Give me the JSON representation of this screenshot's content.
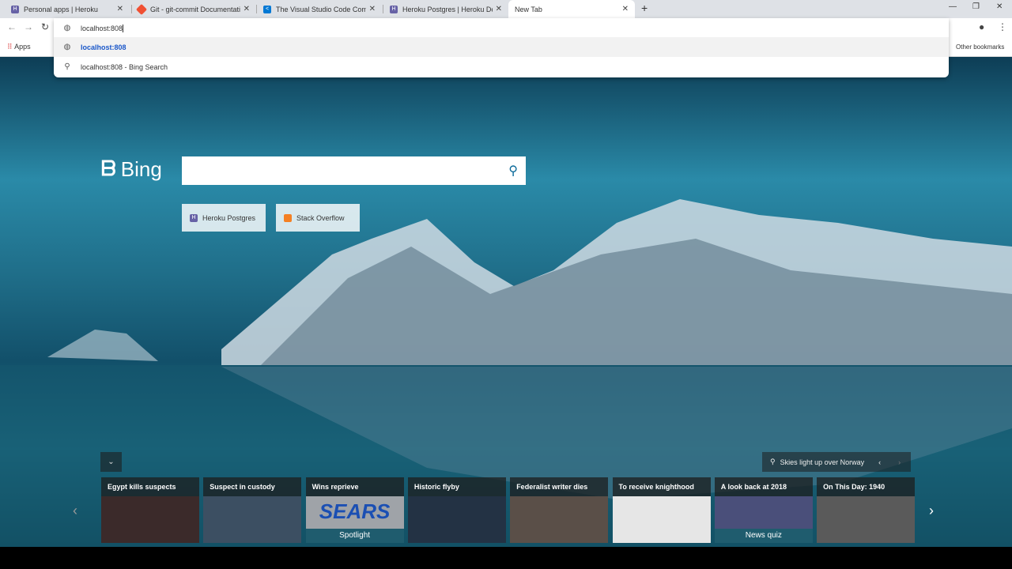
{
  "tabs": [
    {
      "title": "Personal apps | Heroku",
      "favicon": "heroku-icon",
      "color": "#6762a6"
    },
    {
      "title": "Git - git-commit Documentation",
      "favicon": "git-icon",
      "color": "#f05033"
    },
    {
      "title": "The Visual Studio Code Comman",
      "favicon": "vscode-icon",
      "color": "#0078d4"
    },
    {
      "title": "Heroku Postgres | Heroku Dev Ce",
      "favicon": "heroku-icon",
      "color": "#6762a6"
    },
    {
      "title": "New Tab",
      "favicon": "",
      "color": ""
    }
  ],
  "address": {
    "value": "localhost:808"
  },
  "omnibox": {
    "suggestions": [
      {
        "icon": "globe-icon",
        "text": "localhost:808"
      },
      {
        "icon": "search-icon",
        "text": "localhost:808 - Bing Search"
      }
    ]
  },
  "bookmarks": {
    "apps": "Apps",
    "other": "Other bookmarks"
  },
  "bing": {
    "logo": "Bing",
    "search_placeholder": ""
  },
  "quick_links": [
    {
      "label": "Heroku Postgres",
      "icon": "heroku-icon"
    },
    {
      "label": "Stack Overflow",
      "icon": "stackoverflow-icon"
    }
  ],
  "location": "Skies light up over Norway",
  "news": [
    {
      "title": "Egypt kills suspects",
      "caption": ""
    },
    {
      "title": "Suspect in custody",
      "caption": ""
    },
    {
      "title": "Wins reprieve",
      "caption": "Spotlight",
      "image_text": "SEARS"
    },
    {
      "title": "Historic flyby",
      "caption": ""
    },
    {
      "title": "Federalist writer dies",
      "caption": ""
    },
    {
      "title": "To receive knighthood",
      "caption": ""
    },
    {
      "title": "A look back at 2018",
      "caption": "News quiz"
    },
    {
      "title": "On This Day: 1940",
      "caption": ""
    }
  ]
}
